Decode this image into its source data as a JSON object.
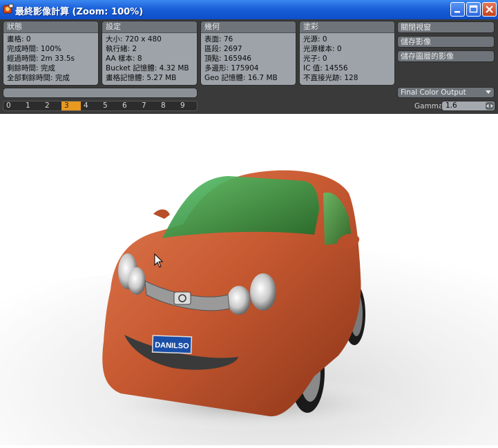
{
  "window": {
    "title": "最終影像計算 (Zoom: 100%)"
  },
  "panels": {
    "status": {
      "header": "狀態",
      "lines": [
        "畫格: 0",
        "完成時間: 100%",
        "經過時間: 2m 33.5s",
        "剩餘時間: 完成",
        "全部剩餘時間: 完成"
      ]
    },
    "settings": {
      "header": "設定",
      "lines": [
        "大小: 720 x 480",
        "執行緒: 2",
        "AA 樣本: 8",
        "Bucket 記憶體: 4.32 MB",
        "畫格記憶體: 5.27 MB"
      ]
    },
    "geometry": {
      "header": "幾何",
      "lines": [
        "表面: 76",
        "區段: 2697",
        "頂點: 165946",
        "多邊形: 175904",
        "Geo 記憶體: 16.7 MB"
      ]
    },
    "shading": {
      "header": "塗彩",
      "lines": [
        "光源: 0",
        "光源樣本: 0",
        "光子: 0",
        "IC 值: 14556",
        "不直接光跡: 128"
      ]
    }
  },
  "buttons": {
    "close_window": "關閉視窗",
    "save_image": "儲存影像",
    "save_layer_images": "儲存圖層的影像"
  },
  "progress": {
    "value": 0
  },
  "frames": {
    "items": [
      "0",
      "1",
      "2",
      "3",
      "4",
      "5",
      "6",
      "7",
      "8",
      "9"
    ],
    "active": "3"
  },
  "output_select": {
    "value": "Final Color Output"
  },
  "gamma": {
    "label": "Gamma",
    "value": "1.6"
  },
  "render": {
    "plate_text": "DANILSO",
    "car_color": "#c85a32",
    "glass_color": "#2e8a3a"
  },
  "colors": {
    "titlebar": "#1a5fd8",
    "panel_bg": "#3a3a3a",
    "frame_active": "#e8991e"
  }
}
